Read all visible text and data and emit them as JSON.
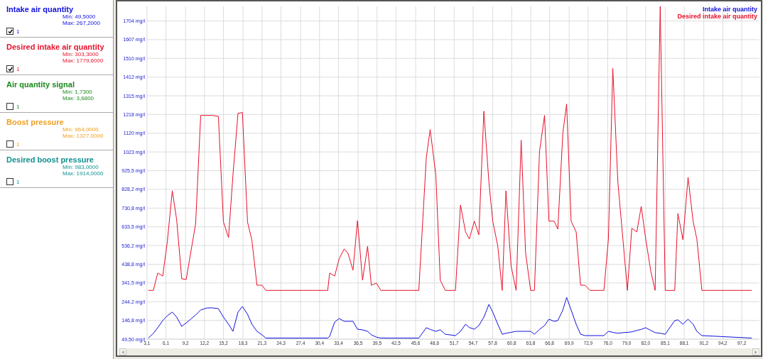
{
  "channels": [
    {
      "name": "Intake air quantity",
      "min": "Min: 49,5000",
      "max": "Max: 267,2000",
      "checked": true,
      "value_label": "1",
      "color": "#1010e0"
    },
    {
      "name": "Desired intake air quantity",
      "min": "Min: 303,3000",
      "max": "Max: 1779,6000",
      "checked": true,
      "value_label": "1",
      "color": "#e8102a"
    },
    {
      "name": "Air quantity signal",
      "min": "Min: 1,7300",
      "max": "Max: 3,6800",
      "checked": false,
      "value_label": "1",
      "color": "#1a8a1a"
    },
    {
      "name": "Boost pressure",
      "min": "Min: 964,0000",
      "max": "Max: 1327,0000",
      "checked": false,
      "value_label": "1",
      "color": "#f0a020"
    },
    {
      "name": "Desired boost pressure",
      "min": "Min: 983,0000",
      "max": "Max: 1914,0000",
      "checked": false,
      "value_label": "1",
      "color": "#109090"
    }
  ],
  "chart": {
    "chart_data": {
      "type": "line",
      "grid": true,
      "xlim": [
        3,
        100
      ],
      "ylim": [
        49.5,
        1780
      ],
      "x": [
        3.3,
        4.1,
        4.8,
        5.6,
        6.3,
        7.1,
        7.8,
        8.6,
        9.3,
        10.0,
        10.8,
        11.6,
        12.6,
        13.5,
        14.4,
        15.2,
        16.0,
        16.7,
        17.5,
        18.2,
        19.0,
        19.7,
        20.5,
        21.3,
        21.9,
        31.7,
        32.0,
        32.8,
        33.5,
        34.3,
        34.9,
        35.7,
        36.4,
        37.2,
        38.0,
        38.6,
        39.4,
        40.1,
        46.1,
        47.3,
        47.9,
        48.8,
        49.5,
        50.3,
        51.9,
        52.7,
        53.5,
        54.1,
        54.9,
        55.6,
        56.4,
        57.2,
        57.8,
        58.6,
        59.3,
        59.9,
        60.7,
        61.5,
        62.3,
        63.0,
        63.8,
        64.4,
        65.2,
        66.0,
        66.7,
        67.5,
        68.1,
        68.9,
        69.5,
        70.2,
        71.0,
        71.7,
        72.4,
        73.2,
        75.4,
        76.1,
        76.8,
        77.6,
        78.4,
        79.1,
        79.8,
        80.6,
        81.3,
        82.0,
        82.8,
        83.5,
        84.3,
        85.1,
        86.6,
        87.1,
        87.9,
        88.7,
        89.5,
        90.1,
        90.9,
        98.8
      ],
      "series": [
        {
          "name": "Intake air quantity",
          "color": "#1010e0",
          "values": [
            55,
            79,
            109,
            146,
            171,
            190,
            164,
            116,
            134,
            153,
            175,
            201,
            212,
            212,
            208,
            164,
            127,
            90,
            190,
            219,
            179,
            127,
            90,
            72,
            55,
            55,
            64,
            138,
            157,
            142,
            142,
            142,
            101,
            98,
            90,
            72,
            60,
            55,
            55,
            109,
            100,
            90,
            98,
            75,
            68,
            90,
            127,
            110,
            101,
            120,
            164,
            230,
            190,
            127,
            75,
            80,
            85,
            90,
            90,
            90,
            90,
            75,
            100,
            120,
            153,
            142,
            146,
            201,
            267,
            201,
            127,
            75,
            68,
            68,
            68,
            90,
            85,
            80,
            83,
            85,
            87,
            95,
            100,
            109,
            95,
            83,
            80,
            75,
            146,
            150,
            127,
            153,
            127,
            90,
            68,
            55
          ]
        },
        {
          "name": "Desired intake air quantity",
          "color": "#e8102a",
          "values": [
            303,
            303,
            393,
            378,
            552,
            821,
            670,
            363,
            360,
            496,
            651,
            1213,
            1213,
            1213,
            1208,
            659,
            578,
            903,
            1224,
            1228,
            659,
            563,
            330,
            330,
            303,
            303,
            393,
            378,
            467,
            519,
            496,
            408,
            666,
            356,
            533,
            330,
            341,
            303,
            303,
            995,
            1139,
            903,
            356,
            303,
            303,
            747,
            607,
            570,
            663,
            592,
            1235,
            866,
            663,
            533,
            303,
            821,
            430,
            303,
            1084,
            500,
            303,
            303,
            1024,
            1213,
            663,
            663,
            622,
            1124,
            1272,
            663,
            607,
            330,
            330,
            303,
            303,
            570,
            1457,
            866,
            570,
            303,
            626,
            607,
            740,
            570,
            404,
            303,
            1780,
            303,
            303,
            703,
            566,
            891,
            663,
            570,
            303,
            303
          ]
        }
      ],
      "xticks": [
        {
          "value": 3.1,
          "label": "3,1"
        },
        {
          "value": 6.1,
          "label": "6,1"
        },
        {
          "value": 9.2,
          "label": "9,2"
        },
        {
          "value": 12.2,
          "label": "12,2"
        },
        {
          "value": 15.2,
          "label": "15,2"
        },
        {
          "value": 18.3,
          "label": "18,3"
        },
        {
          "value": 21.3,
          "label": "21,3"
        },
        {
          "value": 24.3,
          "label": "24,3"
        },
        {
          "value": 27.4,
          "label": "27,4"
        },
        {
          "value": 30.4,
          "label": "30,4"
        },
        {
          "value": 33.4,
          "label": "33,4"
        },
        {
          "value": 36.5,
          "label": "36,5"
        },
        {
          "value": 39.5,
          "label": "39,5"
        },
        {
          "value": 42.5,
          "label": "42,5"
        },
        {
          "value": 45.6,
          "label": "45,6"
        },
        {
          "value": 48.6,
          "label": "48,6"
        },
        {
          "value": 51.7,
          "label": "51,7"
        },
        {
          "value": 54.7,
          "label": "54,7"
        },
        {
          "value": 57.8,
          "label": "57,8"
        },
        {
          "value": 60.8,
          "label": "60,8"
        },
        {
          "value": 63.8,
          "label": "63,8"
        },
        {
          "value": 66.8,
          "label": "66,8"
        },
        {
          "value": 69.9,
          "label": "69,9"
        },
        {
          "value": 72.9,
          "label": "72,9"
        },
        {
          "value": 76.0,
          "label": "76,0"
        },
        {
          "value": 79.0,
          "label": "79,0"
        },
        {
          "value": 82.0,
          "label": "82,0"
        },
        {
          "value": 85.1,
          "label": "85,1"
        },
        {
          "value": 88.1,
          "label": "88,1"
        },
        {
          "value": 91.2,
          "label": "91,2"
        },
        {
          "value": 94.2,
          "label": "94,2"
        },
        {
          "value": 97.2,
          "label": "97,2"
        }
      ],
      "yticks": [
        {
          "value": 49.5,
          "label": "49,50 mg/l"
        },
        {
          "value": 146.8,
          "label": "146,8 mg/l"
        },
        {
          "value": 244.2,
          "label": "244,2 mg/l"
        },
        {
          "value": 341.5,
          "label": "341,5 mg/l"
        },
        {
          "value": 438.8,
          "label": "438,8 mg/l"
        },
        {
          "value": 536.2,
          "label": "536,2 mg/l"
        },
        {
          "value": 633.5,
          "label": "633,5 mg/l"
        },
        {
          "value": 730.8,
          "label": "730,8 mg/l"
        },
        {
          "value": 828.2,
          "label": "828,2 mg/l"
        },
        {
          "value": 925.5,
          "label": "925,5 mg/l"
        },
        {
          "value": 1023,
          "label": "1023 mg/l"
        },
        {
          "value": 1120,
          "label": "1120 mg/l"
        },
        {
          "value": 1218,
          "label": "1218 mg/l"
        },
        {
          "value": 1315,
          "label": "1315 mg/l"
        },
        {
          "value": 1412,
          "label": "1412 mg/l"
        },
        {
          "value": 1510,
          "label": "1510 mg/l"
        },
        {
          "value": 1607,
          "label": "1607 mg/l"
        },
        {
          "value": 1704,
          "label": "1704 mg/l"
        }
      ]
    }
  }
}
